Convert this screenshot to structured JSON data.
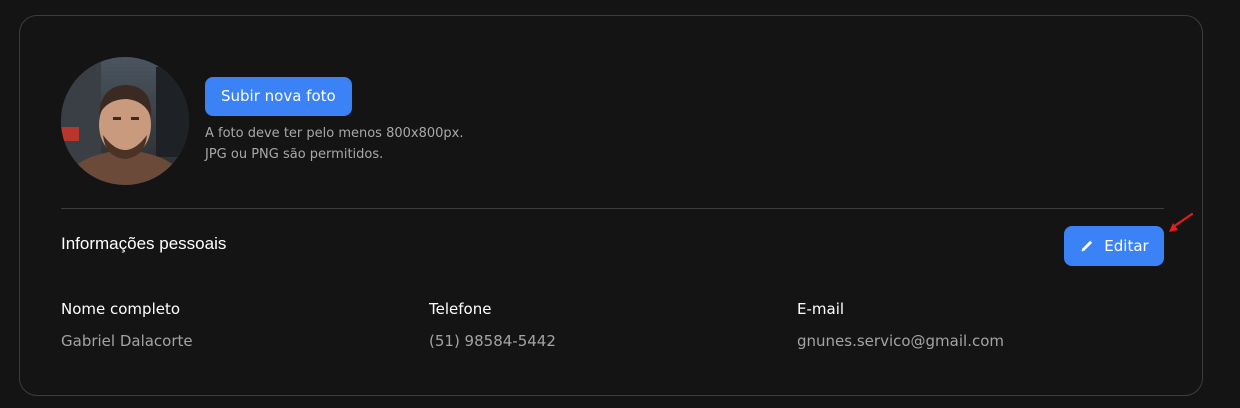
{
  "photo": {
    "upload_label": "Subir nova foto",
    "hint_line1": "A foto deve ter pelo menos 800x800px.",
    "hint_line2": "JPG ou PNG são permitidos."
  },
  "personal": {
    "title": "Informações pessoais",
    "edit_label": "Editar",
    "fields": [
      {
        "label": "Nome completo",
        "value": "Gabriel Dalacorte"
      },
      {
        "label": "Telefone",
        "value": "(51) 98584-5442"
      },
      {
        "label": "E-mail",
        "value": "gnunes.servico@gmail.com"
      }
    ]
  },
  "colors": {
    "accent": "#3b82f6",
    "annotation_arrow": "#e11d1d"
  }
}
